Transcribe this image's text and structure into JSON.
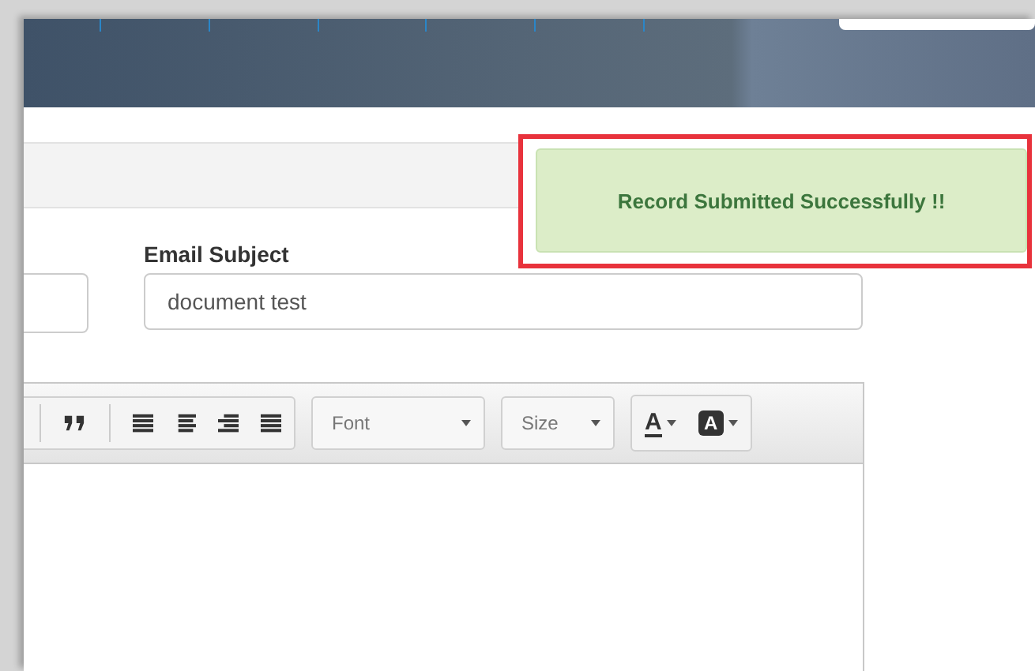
{
  "form": {
    "subject_label": "Email Subject",
    "subject_value": "document test"
  },
  "editor_toolbar": {
    "font_dropdown": "Font",
    "size_dropdown": "Size",
    "text_color_button": "A",
    "background_color_button": "A"
  },
  "toast": {
    "message": "Record Submitted Successfully !!"
  }
}
